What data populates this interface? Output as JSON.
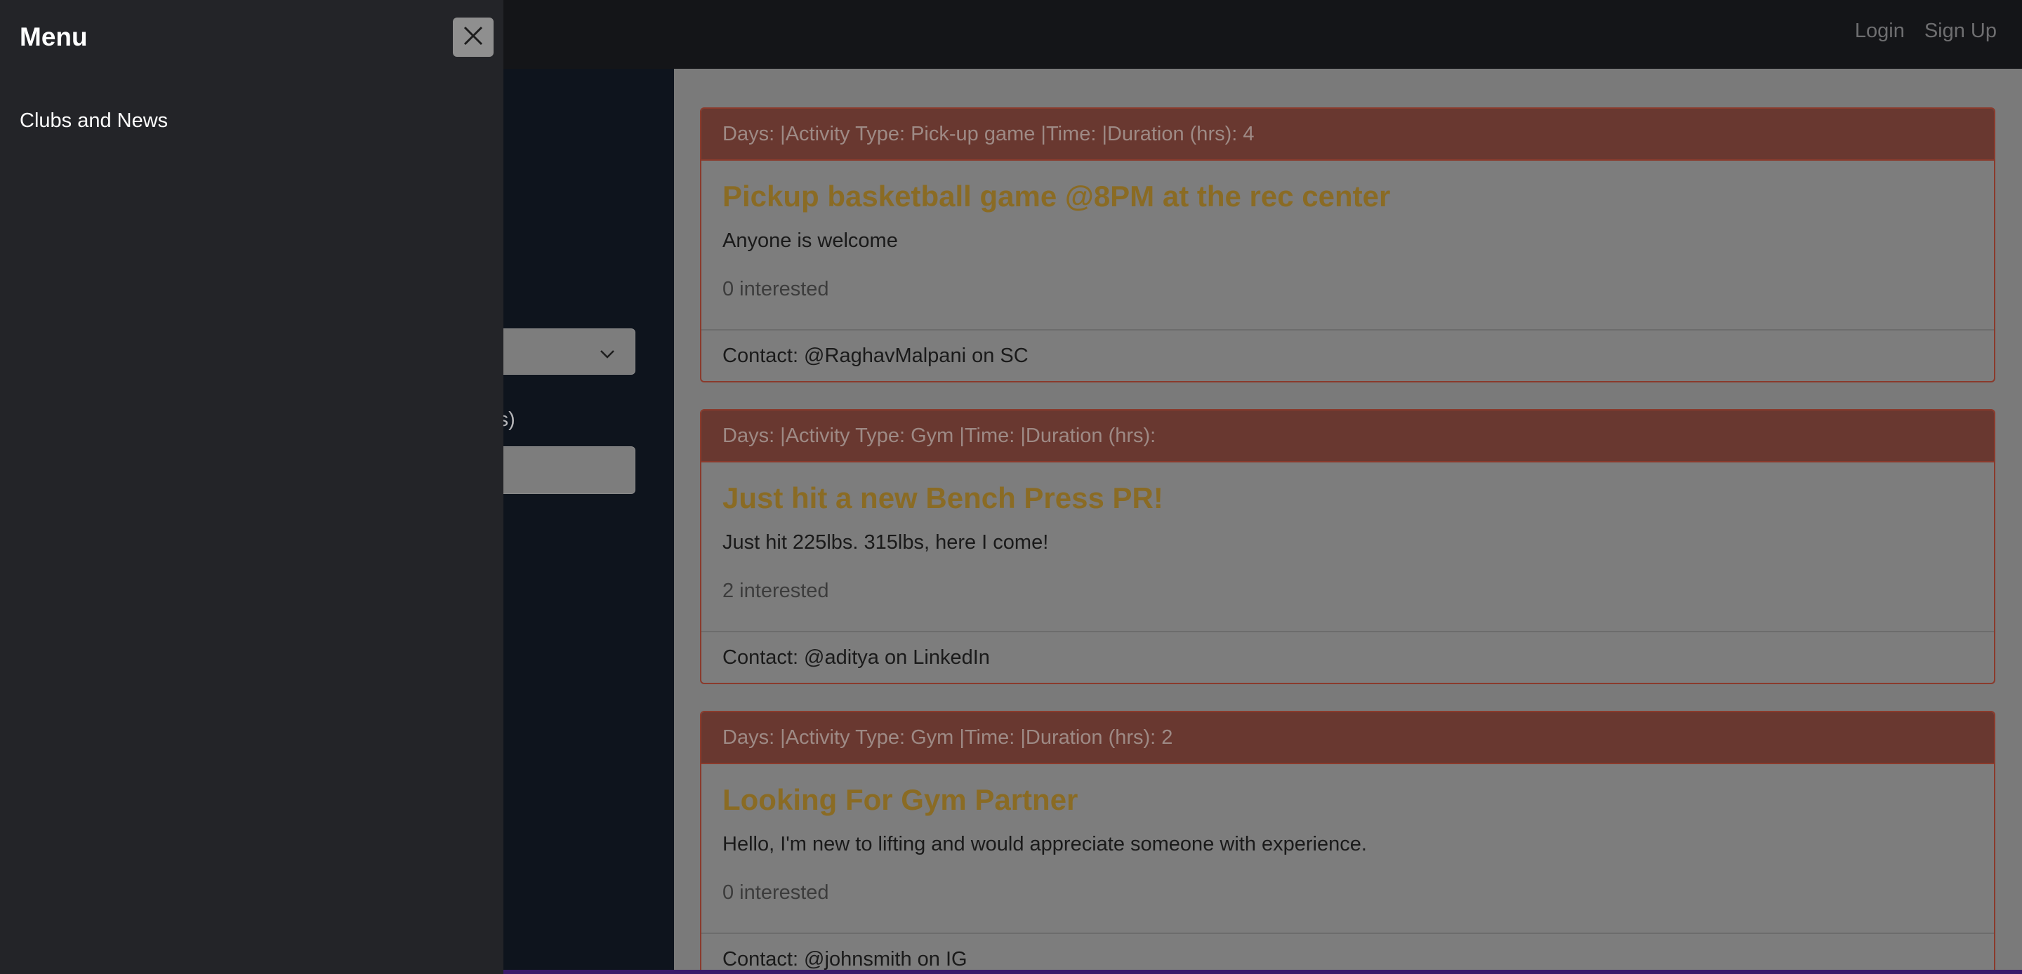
{
  "navbar": {
    "login_label": "Login",
    "signup_label": "Sign Up"
  },
  "form": {
    "duration_label_fragment": "n (hrs)"
  },
  "posts": [
    {
      "header": "Days: |Activity Type: Pick-up game |Time: |Duration (hrs): 4",
      "title": "Pickup basketball game @8PM at the rec center",
      "body": "Anyone is welcome",
      "interested": "0 interested",
      "contact": "Contact: @RaghavMalpani on SC"
    },
    {
      "header": "Days: |Activity Type: Gym |Time: |Duration (hrs):",
      "title": "Just hit a new Bench Press PR!",
      "body": "Just hit 225lbs. 315lbs, here I come!",
      "interested": "2 interested",
      "contact": "Contact: @aditya on LinkedIn"
    },
    {
      "header": "Days: |Activity Type: Gym |Time: |Duration (hrs): 2",
      "title": "Looking For Gym Partner",
      "body": "Hello, I'm new to lifting and would appreciate someone with experience.",
      "interested": "0 interested",
      "contact": "Contact: @johnsmith on IG"
    }
  ],
  "offcanvas": {
    "title": "Menu",
    "links": [
      {
        "label": "Clubs and News"
      }
    ]
  },
  "icons": {
    "close": "close-icon",
    "select_chevron": "chevron-down-icon"
  }
}
